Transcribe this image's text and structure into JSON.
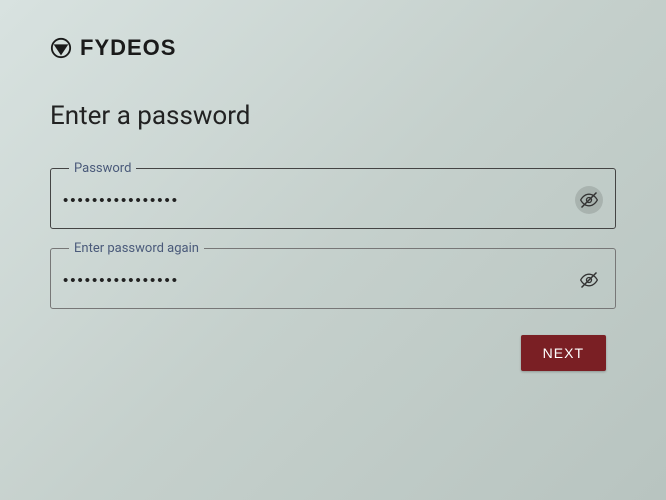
{
  "brand": {
    "name": "FYDEOS"
  },
  "title": "Enter a password",
  "fields": {
    "password": {
      "label": "Password",
      "value": "••••••••••••••••",
      "icon": "eye-off"
    },
    "confirm": {
      "label": "Enter password again",
      "value": "••••••••••••••••",
      "icon": "eye-off"
    }
  },
  "buttons": {
    "next": "NEXT"
  },
  "colors": {
    "accent": "#7a1f24"
  }
}
